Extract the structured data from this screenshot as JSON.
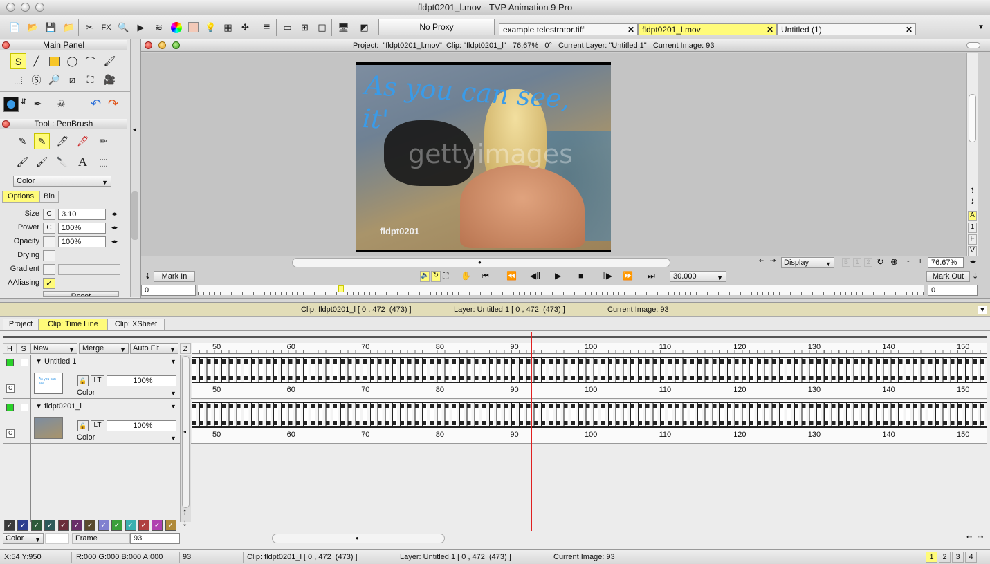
{
  "window": {
    "title": "fldpt0201_l.mov - TVP Animation 9 Pro"
  },
  "toolbar": {
    "proxy_label": "No Proxy",
    "fx_label": "FX",
    "tabs": [
      {
        "label": "example telestrator.tiff",
        "active": false
      },
      {
        "label": "fldpt0201_l.mov",
        "active": true
      },
      {
        "label": "Untitled (1)",
        "active": false
      }
    ]
  },
  "main_panel": {
    "title": "Main Panel"
  },
  "tool_panel": {
    "title": "Tool : PenBrush",
    "mode_select": "Color",
    "tabs": [
      "Options",
      "Bin"
    ],
    "options": {
      "size_label": "Size",
      "size_value": "3.10",
      "power_label": "Power",
      "power_value": "100%",
      "opacity_label": "Opacity",
      "opacity_value": "100%",
      "drying_label": "Drying",
      "gradient_label": "Gradient",
      "aaliasing_label": "AAliasing",
      "c_label": "C",
      "reset_label": "Reset"
    }
  },
  "viewer": {
    "info": "Project:  \"fldpt0201_l.mov\"  Clip: \"fldpt0201_l\"   76.67%   0°   Current Layer: \"Untitled 1\"   Current Image: 93",
    "annotation": "As you can see, it'",
    "watermark": "gettyimages",
    "clip_caption": "fldpt0201",
    "display_select": "Display",
    "zoom_value": "76.67%",
    "mark_in_label": "Mark In",
    "mark_out_label": "Mark Out",
    "fps_value": "30.000",
    "mark_in_value": "0",
    "mark_out_value": "0",
    "side_labels": [
      "A",
      "1",
      "F",
      "V"
    ],
    "page_labels": [
      "1",
      "2"
    ]
  },
  "timeline": {
    "info": {
      "clip": "Clip: fldpt0201_l [ 0 , 472  (473) ]",
      "layer": "Layer: Untitled 1 [ 0 , 472  (473) ]",
      "image": "Current Image: 93"
    },
    "tabs": [
      "Project",
      "Clip: Time Line",
      "Clip: XSheet"
    ],
    "headers": {
      "h": "H",
      "s": "S",
      "new": "New",
      "merge": "Merge",
      "autofit": "Auto Fit",
      "z": "Z"
    },
    "ruler_numbers": [
      "50",
      "60",
      "70",
      "80",
      "90",
      "100",
      "110",
      "120",
      "130",
      "140",
      "150"
    ],
    "layers": [
      {
        "name": "Untitled 1",
        "opacity": "100%",
        "mode": "Color",
        "lt": "LT",
        "c": "C"
      },
      {
        "name": "fldpt0201_l",
        "opacity": "100%",
        "mode": "Color",
        "lt": "LT",
        "c": "C"
      }
    ],
    "bottom": {
      "color_select": "Color",
      "frame_label": "Frame",
      "frame_value": "93"
    },
    "color_swatches": [
      "#3b3b3b",
      "#2d3f8f",
      "#2d5a3a",
      "#2d5a5a",
      "#6a2d3a",
      "#6a2d6a",
      "#5a4a2d",
      "#8080d0",
      "#3aa03a",
      "#3ab0b0",
      "#b04040",
      "#b040b0",
      "#b08a3a"
    ]
  },
  "status": {
    "coords": "X:54  Y:950",
    "rgba": "R:000 G:000 B:000 A:000",
    "frame": "93",
    "clip": "Clip: fldpt0201_l [ 0 , 472  (473) ]",
    "layer": "Layer: Untitled 1 [ 0 , 472  (473) ]",
    "image": "Current Image: 93",
    "pages": [
      "1",
      "2",
      "3",
      "4"
    ]
  },
  "colors": {
    "accent_yellow": "#fffb7a",
    "pen_blue": "#3a9be8",
    "playhead_red": "#e02020"
  }
}
